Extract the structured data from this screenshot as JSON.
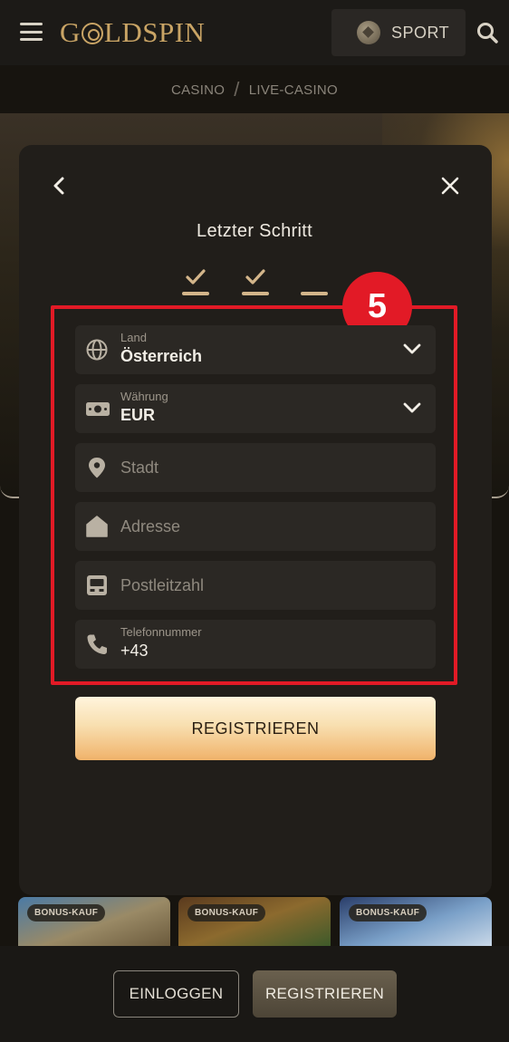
{
  "header": {
    "logo_text_left": "G",
    "logo_text_right": "LDSPIN",
    "sport_label": "SPORT"
  },
  "breadcrumb": {
    "item1": "CASINO",
    "separator": "/",
    "item2": "LIVE-CASINO"
  },
  "modal": {
    "title": "Letzter Schritt",
    "steps": [
      "done",
      "done",
      "current"
    ],
    "highlight_badge": "5",
    "fields": {
      "country": {
        "label": "Land",
        "value": "Österreich",
        "icon": "globe-icon"
      },
      "currency": {
        "label": "Währung",
        "value": "EUR",
        "icon": "money-icon"
      },
      "city": {
        "placeholder": "Stadt",
        "icon": "location-pin-icon"
      },
      "address": {
        "placeholder": "Adresse",
        "icon": "house-icon"
      },
      "zip": {
        "placeholder": "Postleitzahl",
        "icon": "mailbox-icon"
      },
      "phone": {
        "label": "Telefonnummer",
        "value": "+43",
        "icon": "phone-icon"
      }
    },
    "register_label": "REGISTRIEREN"
  },
  "games": {
    "tiles": [
      {
        "tag": "BONUS-KAUF"
      },
      {
        "tag": "BONUS-KAUF"
      },
      {
        "tag": "BONUS-KAUF"
      }
    ]
  },
  "bottom": {
    "login_label": "EINLOGGEN",
    "signup_label": "REGISTRIEREN"
  },
  "colors": {
    "accent_gold": "#c9a465",
    "highlight_red": "#e21a26",
    "modal_bg": "#211e1a"
  }
}
